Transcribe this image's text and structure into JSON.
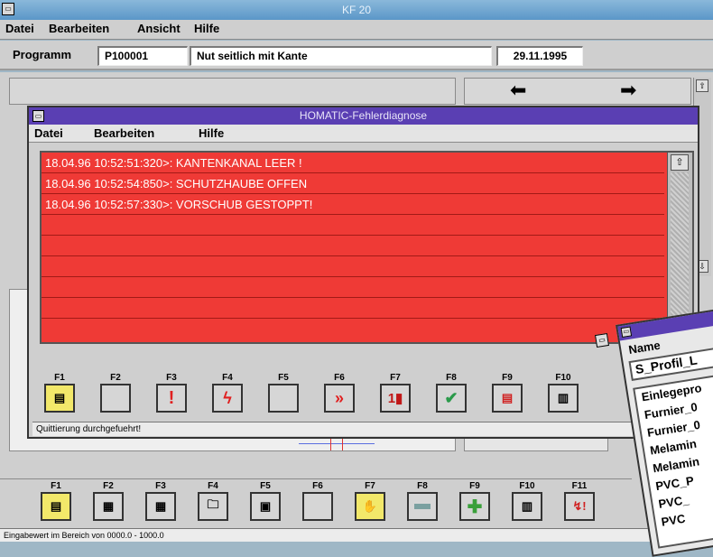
{
  "main": {
    "title": "KF 20",
    "menu": [
      "Datei",
      "Bearbeiten",
      "Ansicht",
      "Hilfe"
    ],
    "program": {
      "label": "Programm",
      "id": "P100001",
      "name": "Nut seitlich mit Kante",
      "date": "29.11.1995"
    },
    "status": "Eingabewert im Bereich von 0000.0 - 1000.0",
    "fkeys": [
      "F1",
      "F2",
      "F3",
      "F4",
      "F5",
      "F6",
      "F7",
      "F8",
      "F9",
      "F10",
      "F11"
    ]
  },
  "dialog": {
    "title": "HOMATIC-Fehlerdiagnose",
    "menu": [
      "Datei",
      "Bearbeiten",
      "Hilfe"
    ],
    "messages": [
      "18.04.96 10:52:51:320>: KANTENKANAL LEER !",
      "18.04.96 10:52:54:850>: SCHUTZHAUBE OFFEN",
      "18.04.96 10:52:57:330>: VORSCHUB GESTOPPT!"
    ],
    "fkeys": [
      "F1",
      "F2",
      "F3",
      "F4",
      "F5",
      "F6",
      "F7",
      "F8",
      "F9",
      "F10"
    ],
    "status": "Quittierung durchgefuehrt!"
  },
  "profile_window": {
    "header": "Name",
    "selected": "S_Profil_L",
    "items": [
      "Einlegepro",
      "Furnier_0",
      "Furnier_0",
      "Melamin",
      "Melamin",
      "PVC_P",
      "PVC_",
      "PVC"
    ]
  },
  "colors": {
    "error_bg": "#ef3a36",
    "dialog_title": "#5a3fb3",
    "main_title": "#5b97c8"
  }
}
